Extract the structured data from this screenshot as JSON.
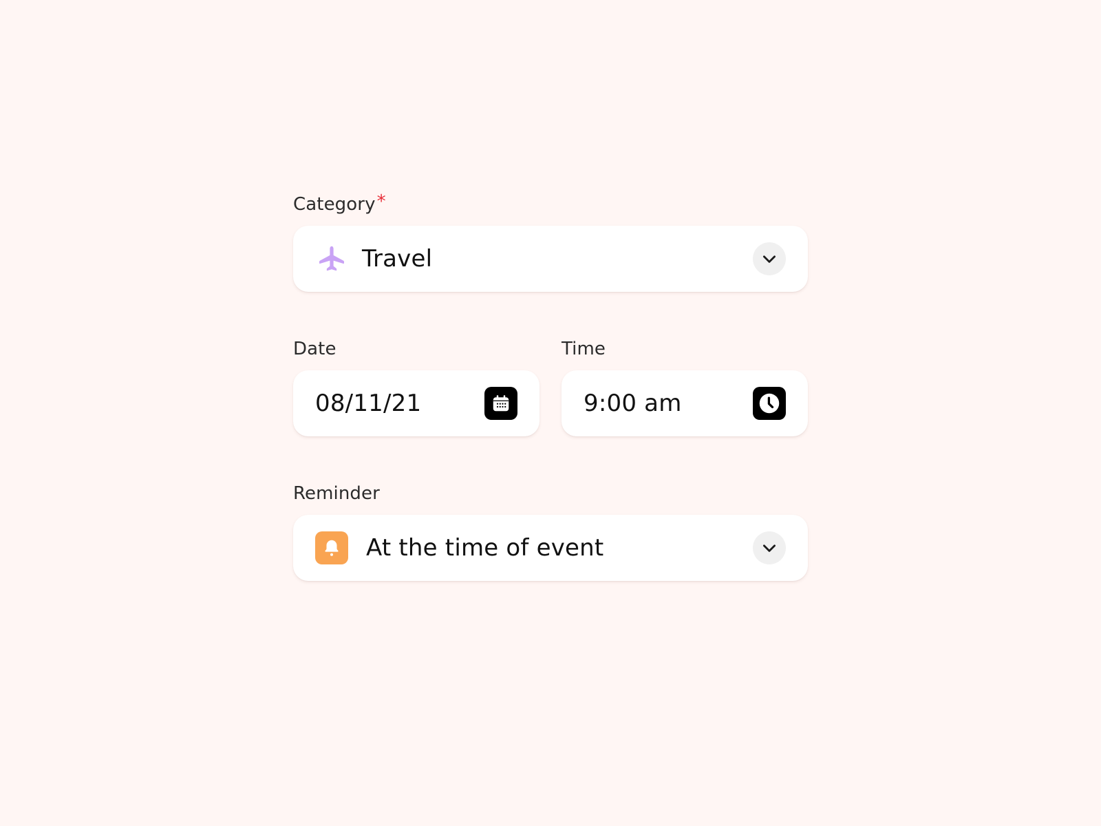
{
  "category": {
    "label": "Category",
    "required_mark": "*",
    "value": "Travel",
    "icon": "airplane-icon",
    "icon_color": "#c9a3f5"
  },
  "date": {
    "label": "Date",
    "value": "08/11/21",
    "icon": "calendar-icon"
  },
  "time": {
    "label": "Time",
    "value": "9:00 am",
    "icon": "clock-icon"
  },
  "reminder": {
    "label": "Reminder",
    "value": "At the time of event",
    "icon": "bell-icon",
    "icon_color": "#f9a452"
  },
  "colors": {
    "background": "#fff6f4",
    "field_bg": "#ffffff",
    "required": "#e8303a"
  }
}
